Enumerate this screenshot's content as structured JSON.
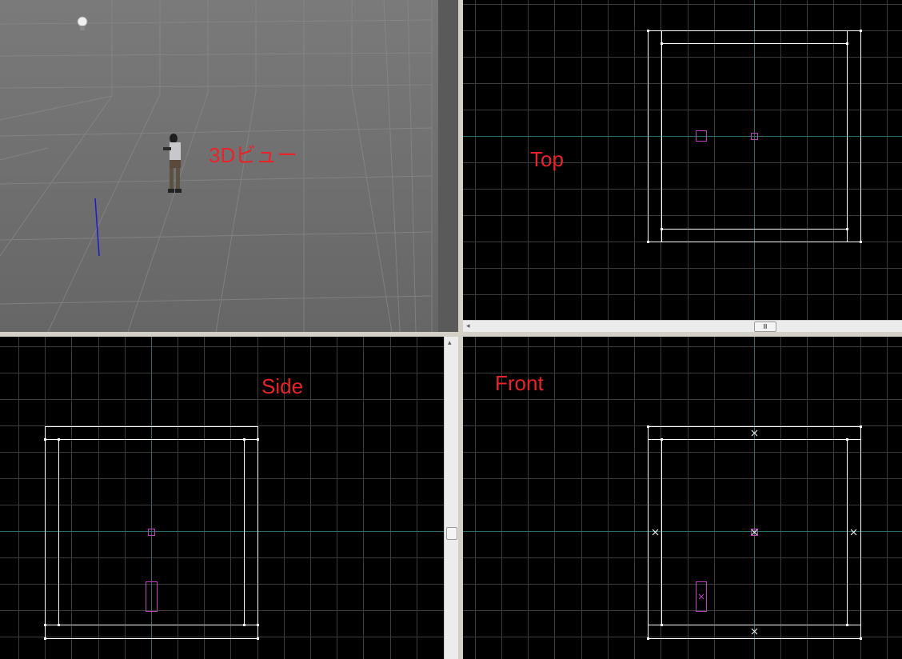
{
  "views": {
    "perspective": {
      "label": "3Dビュー"
    },
    "top": {
      "label": "Top"
    },
    "side": {
      "label": "Side"
    },
    "front": {
      "label": "Front"
    }
  },
  "icons": {
    "light": "lightbulb-icon",
    "player": "player-model-icon",
    "scroll_left": "arrow-left-icon",
    "scroll_up": "arrow-up-icon",
    "grip": "grip-icon"
  },
  "colors": {
    "label": "#e8242a",
    "grid": "#3c3c3c",
    "axis": "#2d6b6b",
    "brush": "#ffffff",
    "entity": "#c040c0",
    "viewport_bg": "#000000",
    "perspective_bg": "#6e6e6e"
  }
}
